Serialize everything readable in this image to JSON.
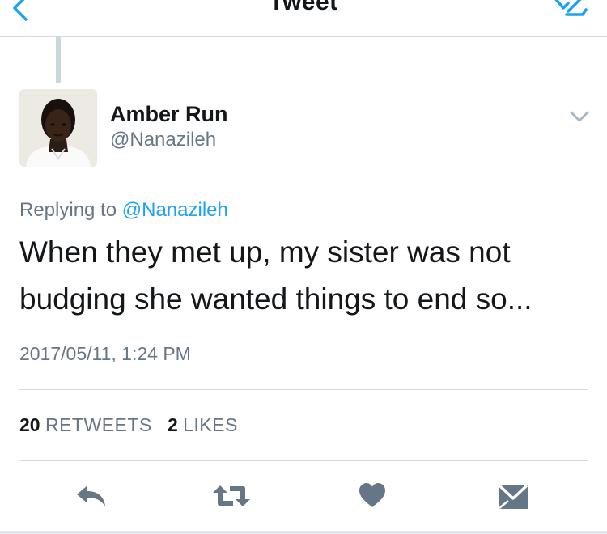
{
  "navbar": {
    "title": "Tweet"
  },
  "tweet": {
    "display_name": "Amber Run",
    "handle": "@Nanazileh",
    "replying_prefix": "Replying to",
    "replying_to": "@Nanazileh",
    "text": "When they met up, my sister was not budging she wanted things to end so...",
    "timestamp": "2017/05/11, 1:24 PM"
  },
  "stats": {
    "retweets_count": "20",
    "retweets_label": "RETWEETS",
    "likes_count": "2",
    "likes_label": "LIKES"
  },
  "icons": {
    "back": "back-chevron-icon",
    "compose": "compose-icon",
    "caret": "chevron-down-icon",
    "reply": "reply-icon",
    "retweet": "retweet-icon",
    "like": "heart-icon",
    "message": "envelope-icon"
  },
  "colors": {
    "accent": "#1da1f2",
    "text": "#14171a",
    "secondary": "#657786",
    "icon": "#657786",
    "divider": "#d6dadd"
  }
}
